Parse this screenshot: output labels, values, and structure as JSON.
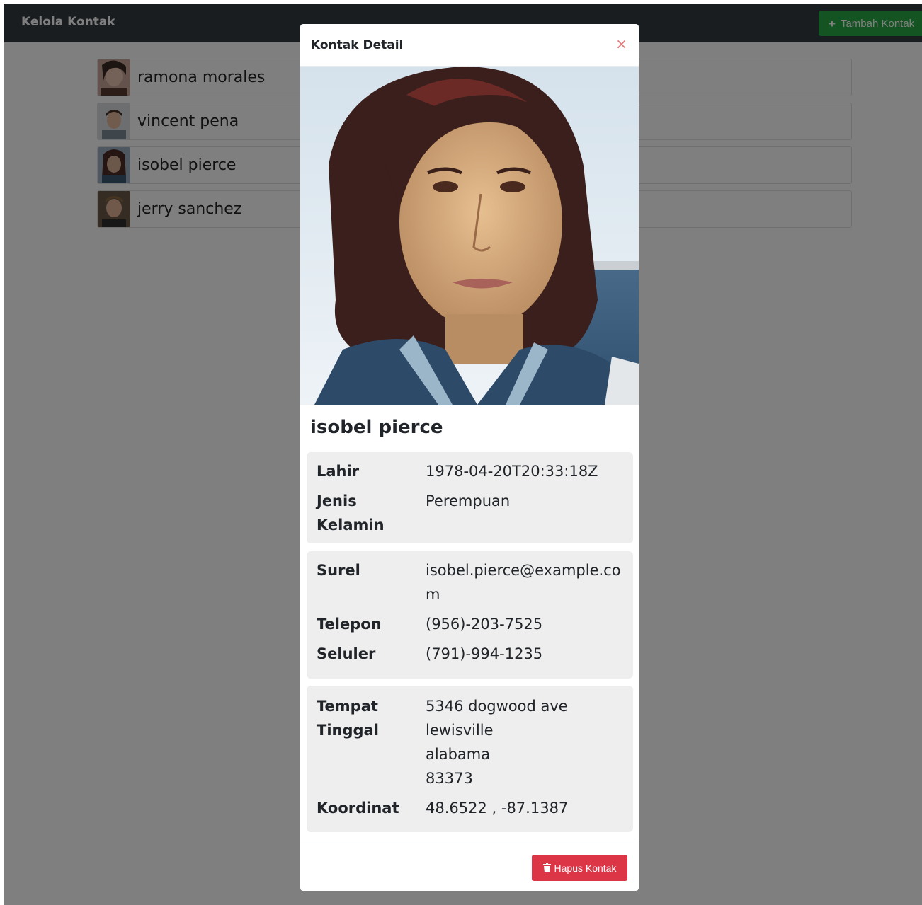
{
  "navbar": {
    "brand": "Kelola Kontak",
    "add_button_label": "Tambah Kontak"
  },
  "contacts": [
    {
      "name": "ramona morales"
    },
    {
      "name": "vincent pena"
    },
    {
      "name": "isobel pierce"
    },
    {
      "name": "jerry sanchez"
    }
  ],
  "modal": {
    "title": "Kontak Detail",
    "close_glyph": "×",
    "name": "isobel pierce",
    "fields": {
      "birth_label": "Lahir",
      "birth_value": "1978-04-20T20:33:18Z",
      "gender_label_1": "Jenis",
      "gender_label_2": "Kelamin",
      "gender_value": "Perempuan",
      "email_label": "Surel",
      "email_value_1": "isobel.pierce@example.co",
      "email_value_2": "m",
      "phone_label": "Telepon",
      "phone_value": "(956)-203-7525",
      "cell_label": "Seluler",
      "cell_value": "(791)-994-1235",
      "address_label_1": "Tempat",
      "address_label_2": "Tinggal",
      "address_street": "5346 dogwood ave",
      "address_city": "lewisville",
      "address_state": "alabama",
      "address_zip": "83373",
      "coord_label": "Koordinat",
      "coord_value": "48.6522 , -87.1387"
    },
    "delete_button_label": "Hapus Kontak"
  },
  "colors": {
    "navbar": "#343a40",
    "add_button": "#28a745",
    "delete_button": "#dc3545",
    "backdrop": "rgba(0,0,0,0.5)",
    "card": "#eeeeee"
  }
}
